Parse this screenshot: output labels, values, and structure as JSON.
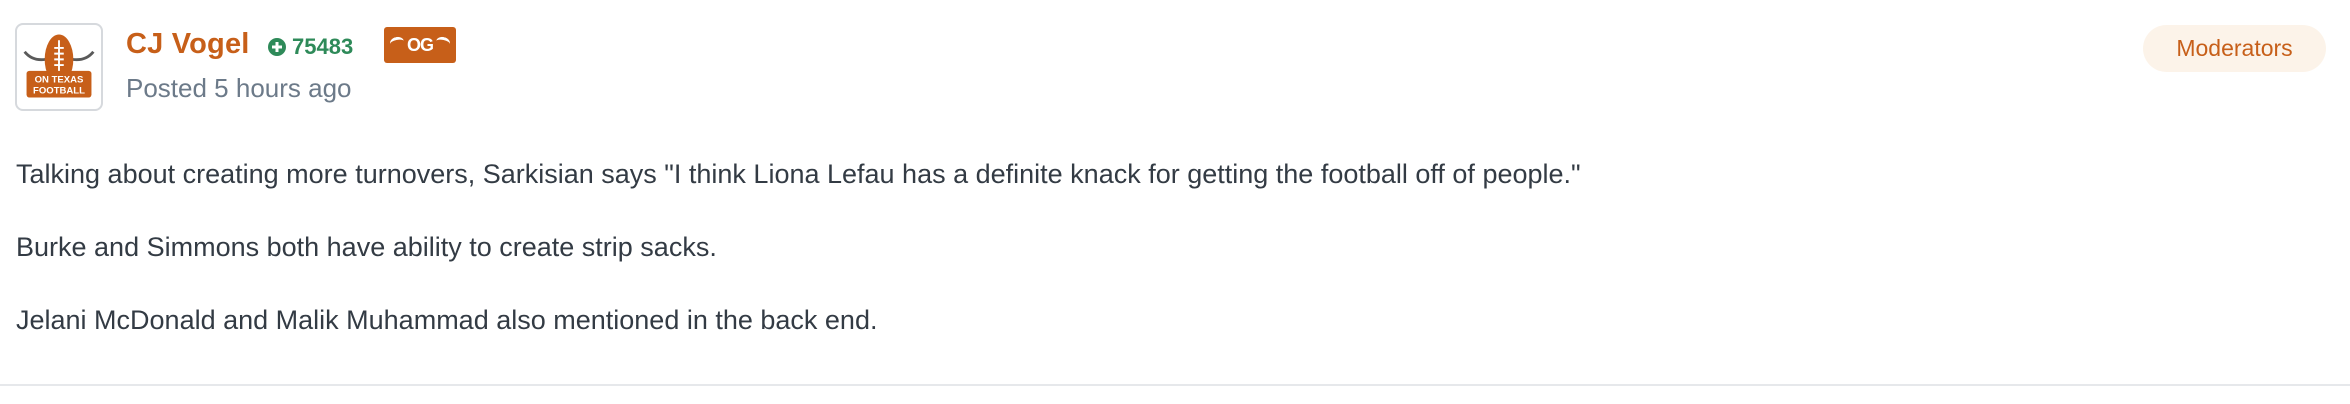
{
  "post": {
    "author": {
      "name": "CJ Vogel",
      "avatar_text_line1": "ON TEXAS",
      "avatar_text_line2": "FOOTBALL",
      "reputation": "75483",
      "badge_text": "OG"
    },
    "posted": "Posted 5 hours ago",
    "group_badge": "Moderators",
    "paragraphs": [
      "Talking about creating more turnovers, Sarkisian says \"I think Liona Lefau has a definite knack for getting the football off of people.\"",
      "Burke and Simmons both have ability to create strip sacks.",
      "Jelani McDonald and Malik Muhammad also mentioned in the back end."
    ]
  },
  "colors": {
    "accent": "#c75f19",
    "reputation": "#2e8a59",
    "muted": "#6c7a89",
    "badge_bg": "#fcf3e9"
  },
  "icons": {
    "avatar": "on-texas-football-logo",
    "reputation": "plus-circle-icon",
    "badge": "longhorn-og-badge"
  }
}
